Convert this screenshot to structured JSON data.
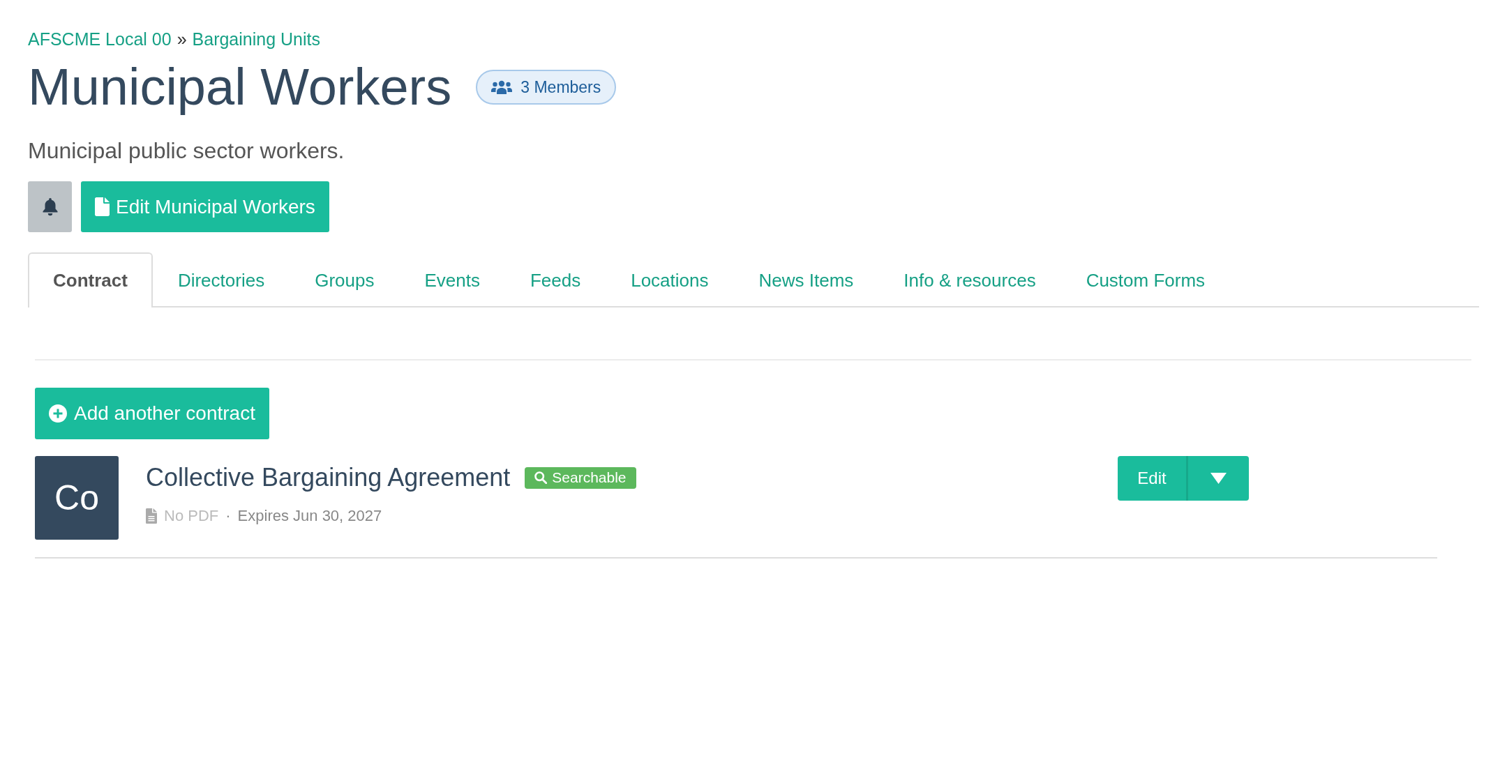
{
  "breadcrumb": {
    "items": [
      "AFSCME Local 00",
      "Bargaining Units"
    ],
    "separator": "»"
  },
  "header": {
    "title": "Municipal Workers",
    "members_badge": "3 Members",
    "description": "Municipal public sector workers."
  },
  "actions": {
    "edit_button": "Edit Municipal Workers"
  },
  "tabs": [
    {
      "label": "Contract",
      "selected": true
    },
    {
      "label": "Directories",
      "selected": false
    },
    {
      "label": "Groups",
      "selected": false
    },
    {
      "label": "Events",
      "selected": false
    },
    {
      "label": "Feeds",
      "selected": false
    },
    {
      "label": "Locations",
      "selected": false
    },
    {
      "label": "News Items",
      "selected": false
    },
    {
      "label": "Info & resources",
      "selected": false
    },
    {
      "label": "Custom Forms",
      "selected": false
    }
  ],
  "contracts": {
    "add_button": "Add another contract",
    "items": [
      {
        "initials": "Co",
        "title": "Collective Bargaining Agreement",
        "badge": "Searchable",
        "pdf_status": "No PDF",
        "separator": "·",
        "expires": "Expires Jun 30, 2027",
        "edit_button": "Edit"
      }
    ]
  }
}
